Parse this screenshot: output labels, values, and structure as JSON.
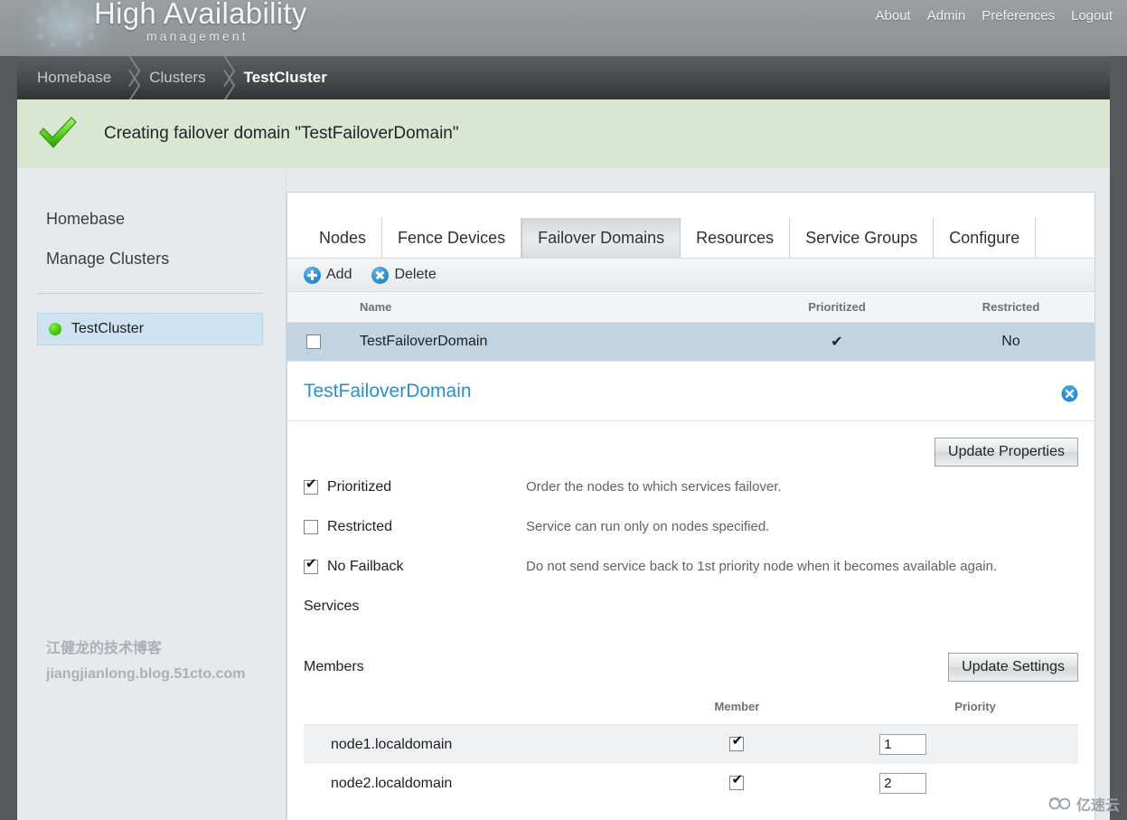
{
  "header": {
    "logo_title": "High Availability",
    "logo_subtitle": "management",
    "nav": [
      {
        "label": "About",
        "name": "nav-about"
      },
      {
        "label": "Admin",
        "name": "nav-admin"
      },
      {
        "label": "Preferences",
        "name": "nav-preferences"
      },
      {
        "label": "Logout",
        "name": "nav-logout"
      }
    ]
  },
  "breadcrumb": {
    "items": [
      {
        "label": "Homebase",
        "active": false
      },
      {
        "label": "Clusters",
        "active": false
      },
      {
        "label": "TestCluster",
        "active": true
      }
    ]
  },
  "notification": {
    "icon": "green-check-icon",
    "message": "Creating failover domain \"TestFailoverDomain\"",
    "background": "#d9e7d2"
  },
  "sidebar": {
    "links": [
      {
        "label": "Homebase"
      },
      {
        "label": "Manage Clusters"
      }
    ],
    "cluster": {
      "label": "TestCluster",
      "status_color": "#45c90f"
    },
    "watermark": {
      "line1": "江健龙的技术博客",
      "line2": "jiangjianlong.blog.51cto.com"
    }
  },
  "tabs": [
    {
      "label": "Nodes",
      "active": false
    },
    {
      "label": "Fence Devices",
      "active": false
    },
    {
      "label": "Failover Domains",
      "active": true
    },
    {
      "label": "Resources",
      "active": false
    },
    {
      "label": "Service Groups",
      "active": false
    },
    {
      "label": "Configure",
      "active": false
    }
  ],
  "toolbar": {
    "add_label": "Add",
    "delete_label": "Delete"
  },
  "domain_table": {
    "columns": [
      "Name",
      "Prioritized",
      "Restricted"
    ],
    "rows": [
      {
        "selected_checkbox": false,
        "name": "TestFailoverDomain",
        "prioritized": "✔",
        "restricted": "No"
      }
    ]
  },
  "detail": {
    "title": "TestFailoverDomain",
    "close_icon": "close-icon",
    "update_properties_label": "Update Properties",
    "options": [
      {
        "label": "Prioritized",
        "checked": true,
        "description": "Order the nodes to which services failover."
      },
      {
        "label": "Restricted",
        "checked": false,
        "description": "Service can run only on nodes specified."
      },
      {
        "label": "No Failback",
        "checked": true,
        "description": "Do not send service back to 1st priority node when it becomes available again."
      }
    ],
    "services_label": "Services",
    "members_label": "Members",
    "update_settings_label": "Update Settings",
    "members_table": {
      "columns": [
        "Member",
        "Priority"
      ],
      "rows": [
        {
          "node": "node1.localdomain",
          "member_checked": true,
          "priority": "1"
        },
        {
          "node": "node2.localdomain",
          "member_checked": true,
          "priority": "2"
        }
      ]
    }
  },
  "corner_watermark": {
    "text": "亿速云",
    "icon": "cloud-icon"
  }
}
